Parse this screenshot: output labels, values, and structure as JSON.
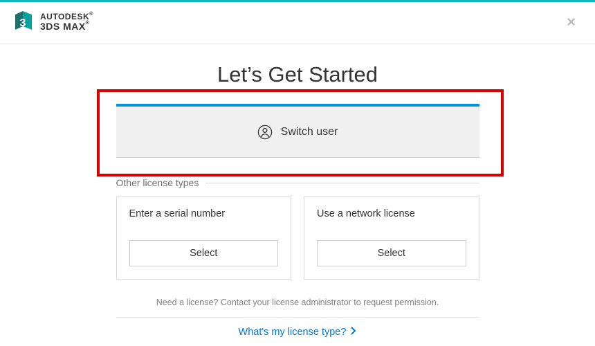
{
  "brand": {
    "line1": "AUTODESK",
    "line2": "3DS MAX"
  },
  "pageTitle": "Let’s Get Started",
  "switchUser": {
    "label": "Switch user"
  },
  "otherSection": {
    "title": "Other license types"
  },
  "options": [
    {
      "title": "Enter a serial number",
      "button": "Select"
    },
    {
      "title": "Use a network license",
      "button": "Select"
    }
  ],
  "helpText": "Need a license? Contact your license administrator to request permission.",
  "link": {
    "label": "What's my license type?"
  }
}
